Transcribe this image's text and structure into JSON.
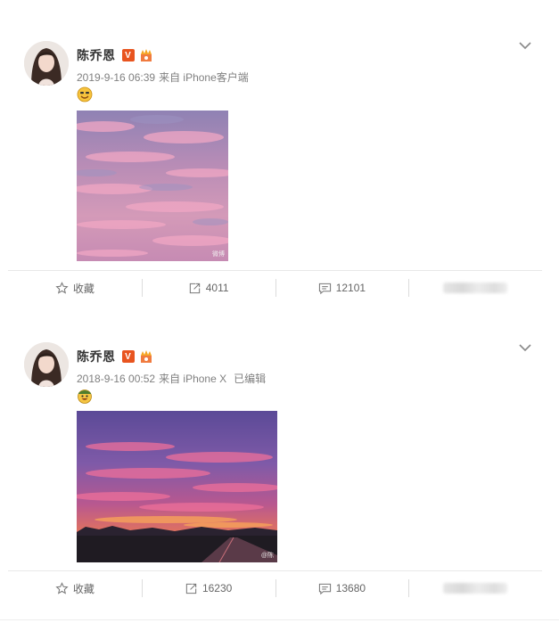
{
  "posts": [
    {
      "author": "陈乔恩",
      "timestamp": "2019-9-16 06:39",
      "source": "来自 iPhone客户端",
      "edited": "",
      "text_icon": "smiling-face-emoji-icon",
      "photo_watermark": "微博",
      "actions": {
        "favorite_label": "收藏",
        "repost_count": "4011",
        "comment_count": "12101"
      }
    },
    {
      "author": "陈乔恩",
      "timestamp": "2018-9-16 00:52",
      "source": "来自 iPhone X",
      "edited": "已编辑",
      "text_icon": "grinning-face-emoji-icon",
      "photo_watermark": "@陈",
      "actions": {
        "favorite_label": "收藏",
        "repost_count": "16230",
        "comment_count": "13680"
      }
    }
  ],
  "colors": {
    "verified_badge": "#e8541f",
    "meta_text": "#808080",
    "action_text": "#666666"
  }
}
